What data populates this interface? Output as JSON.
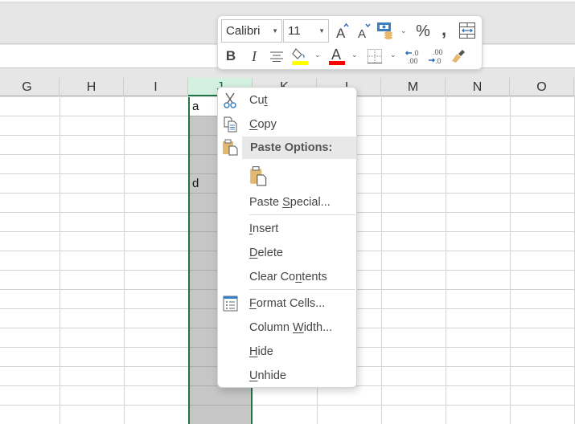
{
  "spreadsheet": {
    "columns": [
      {
        "label": "G",
        "selected": false
      },
      {
        "label": "H",
        "selected": false
      },
      {
        "label": "I",
        "selected": false
      },
      {
        "label": "J",
        "selected": true
      },
      {
        "label": "K",
        "selected": false
      },
      {
        "label": "L",
        "selected": false
      },
      {
        "label": "M",
        "selected": false
      },
      {
        "label": "N",
        "selected": false
      },
      {
        "label": "O",
        "selected": false
      }
    ],
    "cells": [
      {
        "column": "J",
        "row_index": 0,
        "value": "a"
      },
      {
        "column": "J",
        "row_index": 4,
        "value": "d"
      }
    ],
    "selection": {
      "column": "J",
      "active_row_index": 0
    },
    "selection_color": "#217346"
  },
  "mini_toolbar": {
    "font_name": "Calibri",
    "font_size": "11",
    "buttons_row1": [
      {
        "name": "increase-font-size",
        "icon": "font-grow-icon",
        "glyph": "A"
      },
      {
        "name": "decrease-font-size",
        "icon": "font-shrink-icon",
        "glyph": "A"
      },
      {
        "name": "accounting-number-format",
        "icon": "currency-icon"
      },
      {
        "name": "percent-style",
        "icon": "percent-icon",
        "glyph": "%"
      },
      {
        "name": "comma-style",
        "icon": "comma-icon",
        "glyph": ","
      },
      {
        "name": "merge-and-center",
        "icon": "merge-center-icon"
      }
    ],
    "buttons_row2": [
      {
        "name": "bold",
        "icon": "bold-icon",
        "glyph": "B"
      },
      {
        "name": "italic",
        "icon": "italic-icon",
        "glyph": "I"
      },
      {
        "name": "center",
        "icon": "align-center-icon"
      },
      {
        "name": "fill-color",
        "icon": "fill-color-icon",
        "color": "#ffff00"
      },
      {
        "name": "font-color",
        "icon": "font-color-icon",
        "glyph": "A",
        "color": "#ff0000"
      },
      {
        "name": "borders",
        "icon": "borders-icon"
      },
      {
        "name": "increase-decimal",
        "icon": "increase-decimal-icon",
        "top": ".0",
        "bottom": ".00"
      },
      {
        "name": "decrease-decimal",
        "icon": "decrease-decimal-icon",
        "top": ".00",
        "bottom": ".0"
      },
      {
        "name": "format-painter",
        "icon": "format-painter-icon"
      }
    ]
  },
  "context_menu": {
    "items": [
      {
        "label_pre": "Cu",
        "label_ul": "t",
        "label_post": "",
        "icon": "scissors-icon"
      },
      {
        "label_pre": "",
        "label_ul": "C",
        "label_post": "opy",
        "icon": "copy-icon"
      },
      {
        "label": "Paste Options:",
        "icon": "paste-icon",
        "type": "header"
      },
      {
        "icon": "paste-option-icon",
        "type": "paste-option"
      },
      {
        "label_pre": "Paste ",
        "label_ul": "S",
        "label_post": "pecial...",
        "icon": null
      },
      {
        "label_pre": "",
        "label_ul": "I",
        "label_post": "nsert",
        "icon": null
      },
      {
        "label_pre": "",
        "label_ul": "D",
        "label_post": "elete",
        "icon": null
      },
      {
        "label_pre": "Clear Co",
        "label_ul": "n",
        "label_post": "tents",
        "icon": null
      },
      {
        "label_pre": "",
        "label_ul": "F",
        "label_post": "ormat Cells...",
        "icon": "format-cells-icon"
      },
      {
        "label_pre": "Column ",
        "label_ul": "W",
        "label_post": "idth...",
        "icon": null
      },
      {
        "label_pre": "",
        "label_ul": "H",
        "label_post": "ide",
        "icon": null
      },
      {
        "label_pre": "",
        "label_ul": "U",
        "label_post": "nhide",
        "icon": null
      }
    ]
  }
}
